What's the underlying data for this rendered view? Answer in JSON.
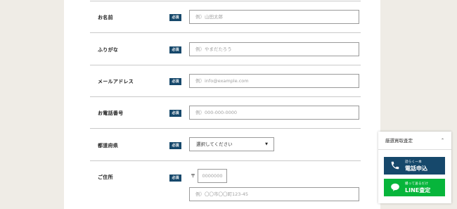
{
  "form": {
    "required_badge": "必須",
    "fields": [
      {
        "label": "お名前",
        "placeholder": "例）山田太郎"
      },
      {
        "label": "ふりがな",
        "placeholder": "例）やまだたろう"
      },
      {
        "label": "メールアドレス",
        "placeholder": "例）info@example.com"
      },
      {
        "label": "お電話番号",
        "placeholder": "例）000-000-0000"
      },
      {
        "label": "都道府県",
        "select_value": "選択してください"
      },
      {
        "label": "ご住所",
        "postal_mark": "〒",
        "postal_placeholder": "0000000",
        "address_placeholder": "例）〇〇市〇〇町123-45"
      }
    ]
  },
  "widget": {
    "title": "厳選買取査定",
    "tel": {
      "small": "話らく一本",
      "big": "電話申込"
    },
    "line": {
      "small": "撮って送るだけ",
      "big": "LINE査定"
    }
  }
}
